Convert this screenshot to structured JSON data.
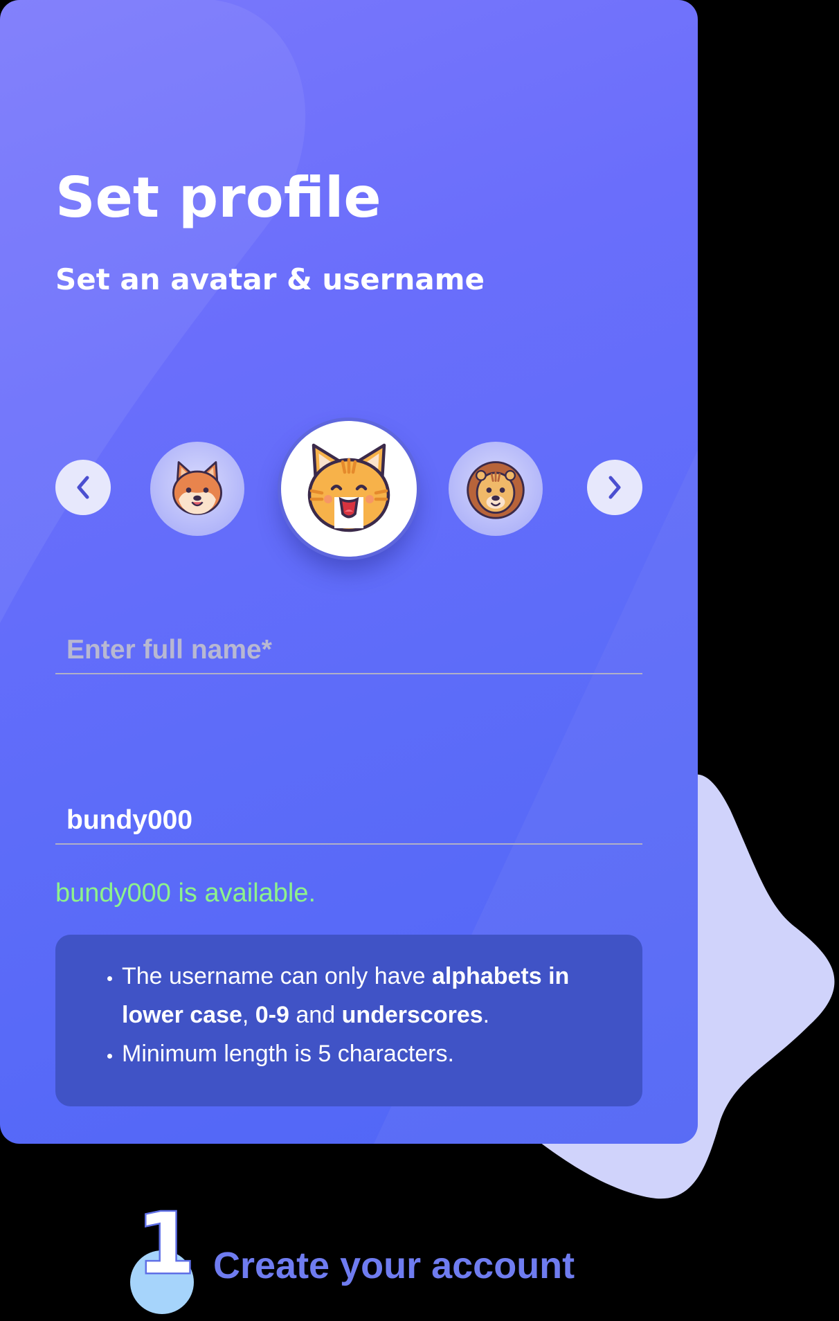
{
  "profile": {
    "title": "Set profile",
    "subtitle": "Set an avatar & username"
  },
  "avatars": {
    "items": [
      "shiba-dog-avatar",
      "cat-avatar",
      "lion-avatar"
    ],
    "selected": "cat-avatar"
  },
  "form": {
    "full_name": {
      "value": "",
      "placeholder": "Enter full name*"
    },
    "username": {
      "value": "bundy000",
      "placeholder": ""
    },
    "availability": "bundy000 is available."
  },
  "rules": {
    "rule1": {
      "text_a": "The username can only have ",
      "bold_a": "alphabets in lower case",
      "text_b": ", ",
      "bold_b": "0-9",
      "text_c": " and ",
      "bold_c": "underscores",
      "text_d": "."
    },
    "rule2": "Minimum length is 5 characters."
  },
  "step": {
    "number": "1",
    "label": "Create your account"
  },
  "colors": {
    "card_gradient": [
      "#7a78fb",
      "#5066f6"
    ],
    "rules_box": "#4053c6",
    "available_text": "#8ef28c",
    "step_label": "#6f7cf0",
    "background_blob": "#d0d3fb"
  },
  "icons": {
    "prev": "chevron-left-icon",
    "next": "chevron-right-icon"
  }
}
